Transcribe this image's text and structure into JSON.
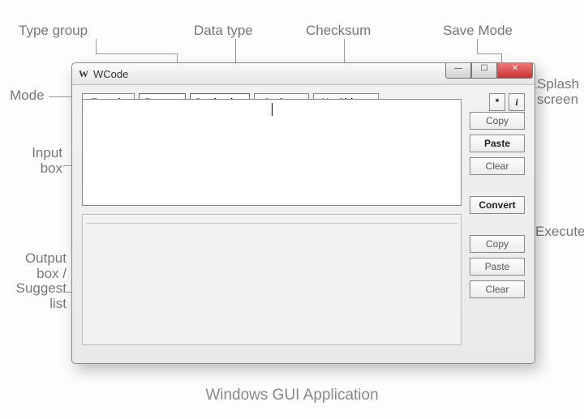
{
  "annotations": {
    "type_group": "Type group",
    "data_type": "Data type",
    "checksum": "Checksum",
    "save_mode": "Save Mode",
    "mode": "Mode",
    "splash_screen": "Splash screen",
    "input_box": "Input box",
    "output_box": "Output box / Suggest list",
    "execute": "Execute"
  },
  "window": {
    "title": "WCode",
    "icon_glyph": "W"
  },
  "toolbar": {
    "encode": "Encode",
    "type_group": "Raw",
    "data_type": "Decimal",
    "options": "Options",
    "checksum": "No Chksm",
    "save_mode": "*",
    "info": "i"
  },
  "side": {
    "copy": "Copy",
    "paste": "Paste",
    "clear": "Clear",
    "convert": "Convert"
  },
  "caption": "Windows GUI Application"
}
